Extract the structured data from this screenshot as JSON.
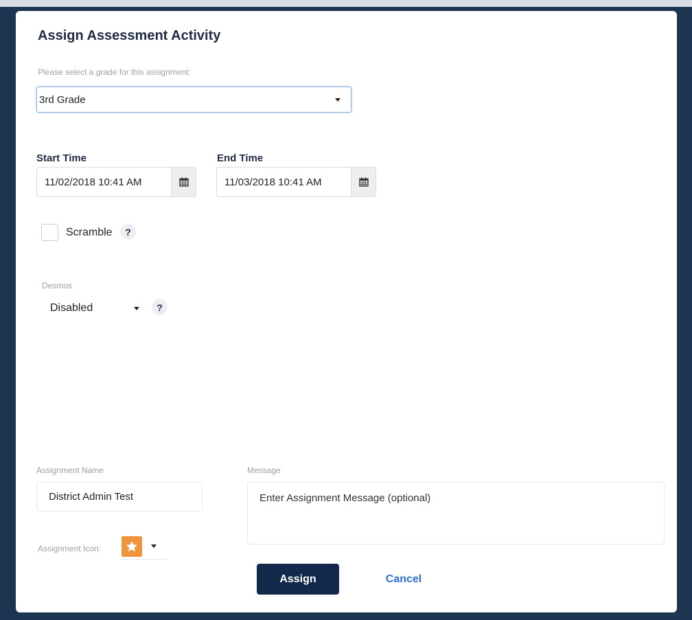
{
  "modal": {
    "title": "Assign Assessment Activity",
    "grade_hint": "Please select a grade for this assignment:",
    "grade_value": "3rd Grade"
  },
  "schedule": {
    "start_label": "Start Time",
    "start_value": "11/02/2018 10:41 AM",
    "end_label": "End Time",
    "end_value": "11/03/2018 10:41 AM"
  },
  "scramble": {
    "label": "Scramble",
    "checked": false,
    "help": "?"
  },
  "desmos": {
    "label": "Desmos",
    "value": "Disabled",
    "help": "?"
  },
  "assignment": {
    "name_label": "Assignment Name",
    "name_value": "District Admin Test",
    "message_label": "Message",
    "message_placeholder": "Enter Assignment Message (optional)",
    "icon_label": "Assignment Icon:",
    "icon": "star-icon",
    "icon_color": "#f0953e"
  },
  "actions": {
    "assign_label": "Assign",
    "cancel_label": "Cancel",
    "assign_color": "#13294b",
    "cancel_color": "#2f6fd1"
  }
}
